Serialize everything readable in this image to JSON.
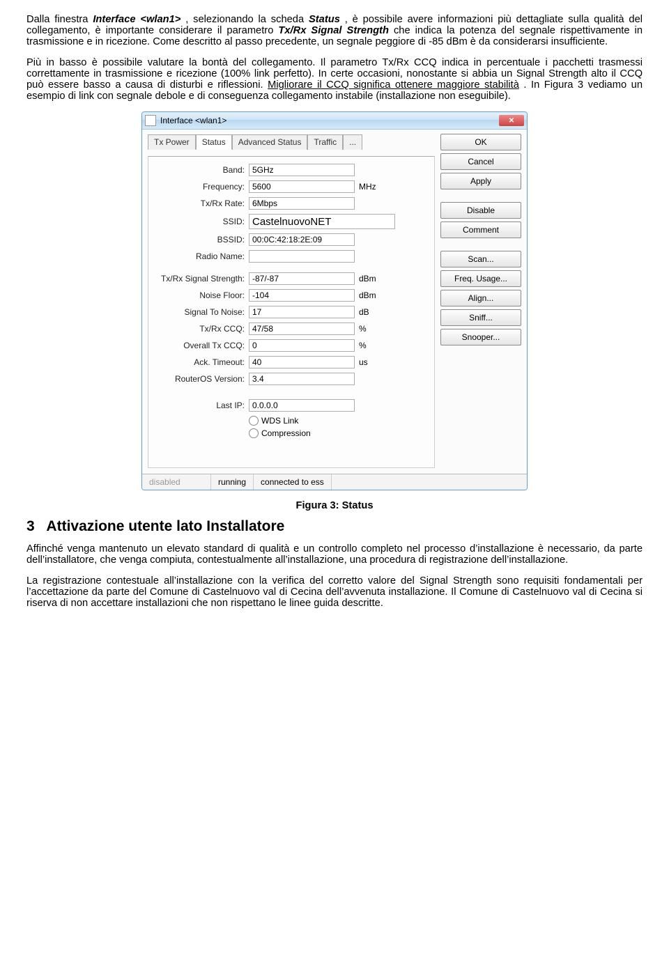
{
  "para1_pre": "Dalla finestra ",
  "para1_em1": "Interface <wlan1>",
  "para1_mid1": ", selezionando la scheda ",
  "para1_em2": "Status",
  "para1_mid2": ", è possibile avere informazioni più dettagliate sulla qualità del collegamento, è importante considerare il parametro ",
  "para1_em3": "Tx/Rx Signal Strength",
  "para1_post": " che indica la potenza del segnale rispettivamente in trasmissione e in ricezione. Come descritto al passo precedente, un segnale peggiore di -85 dBm è da considerarsi insufficiente.",
  "para2_a": "Più in basso è possibile valutare la bontà del collegamento. Il parametro Tx/Rx CCQ indica in percentuale i pacchetti trasmessi correttamente in trasmissione e ricezione (100% link perfetto). In certe occasioni, nonostante si abbia un Signal Strength alto il CCQ può essere basso a causa di disturbi e riflessioni. ",
  "para2_u": "Migliorare il CCQ significa ottenere maggiore stabilità",
  "para2_b": ". In Figura 3 vediamo un esempio di link con segnale debole e di conseguenza collegamento instabile (installazione non eseguibile).",
  "window": {
    "title": "Interface <wlan1>",
    "tabs": [
      "Tx Power",
      "Status",
      "Advanced Status",
      "Traffic",
      "..."
    ],
    "active_tab": 1,
    "fields": {
      "Band": {
        "value": "5GHz",
        "unit": ""
      },
      "Frequency": {
        "value": "5600",
        "unit": "MHz"
      },
      "TxRxRate": {
        "label": "Tx/Rx Rate:",
        "value": "6Mbps",
        "unit": ""
      },
      "SSID": {
        "value": "CastelnuovoNET",
        "unit": ""
      },
      "BSSID": {
        "value": "00:0C:42:18:2E:09",
        "unit": ""
      },
      "RadioName": {
        "label": "Radio Name:",
        "value": "",
        "unit": ""
      },
      "TxRxSignal": {
        "label": "Tx/Rx Signal Strength:",
        "value": "-87/-87",
        "unit": "dBm"
      },
      "NoiseFloor": {
        "label": "Noise Floor:",
        "value": "-104",
        "unit": "dBm"
      },
      "SignalToNoise": {
        "label": "Signal To Noise:",
        "value": "17",
        "unit": "dB"
      },
      "TxRxCCQ": {
        "label": "Tx/Rx CCQ:",
        "value": "47/58",
        "unit": "%"
      },
      "OverallTxCCQ": {
        "label": "Overall Tx CCQ:",
        "value": "0",
        "unit": "%"
      },
      "AckTimeout": {
        "label": "Ack. Timeout:",
        "value": "40",
        "unit": "us"
      },
      "RouterOS": {
        "label": "RouterOS Version:",
        "value": "3.4",
        "unit": ""
      },
      "LastIP": {
        "label": "Last IP:",
        "value": "0.0.0.0",
        "unit": ""
      }
    },
    "radios": [
      "WDS Link",
      "Compression"
    ],
    "buttons": [
      "OK",
      "Cancel",
      "Apply",
      "Disable",
      "Comment",
      "Scan...",
      "Freq. Usage...",
      "Align...",
      "Sniff...",
      "Snooper..."
    ],
    "status": [
      "disabled",
      "running",
      "connected to ess"
    ]
  },
  "caption": "Figura 3: Status",
  "heading_num": "3",
  "heading_txt": "Attivazione utente lato Installatore",
  "para3": "Affinché venga mantenuto un elevato standard di qualità e un controllo completo nel processo d’installazione è necessario, da parte dell’installatore, che venga compiuta, contestualmente all’installazione, una procedura di registrazione dell’installazione.",
  "para4": "La registrazione contestuale all’installazione con la verifica del corretto valore del Signal Strength sono requisiti fondamentali per l’accettazione da parte del Comune di Castelnuovo val di Cecina dell’avvenuta installazione. Il Comune di Castelnuovo val di Cecina si riserva di non accettare installazioni che non rispettano le linee guida descritte."
}
